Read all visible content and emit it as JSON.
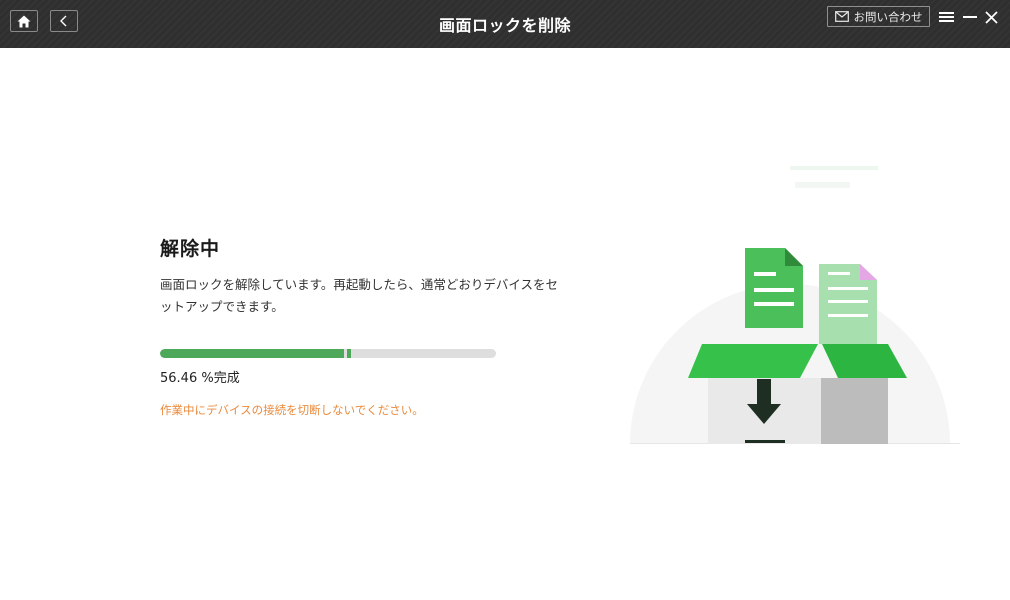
{
  "header": {
    "title": "画面ロックを削除",
    "contact_label": "お問い合わせ"
  },
  "icons": {
    "home": "home-icon",
    "back": "chevron-left-icon",
    "mail": "mail-icon",
    "menu": "menu-icon",
    "minimize": "minimize-icon",
    "close": "close-icon"
  },
  "main": {
    "status_title": "解除中",
    "description": "画面ロックを解除しています。再起動したら、通常どおりデバイスをセットアップできます。",
    "progress_value": 56.46,
    "progress_text": "56.46 %完成",
    "warning": "作業中にデバイスの接続を切断しないでください。"
  },
  "colors": {
    "titlebar": "#2e2f2e",
    "accent_green": "#4ea85a",
    "warning_orange": "#e98a3c"
  }
}
